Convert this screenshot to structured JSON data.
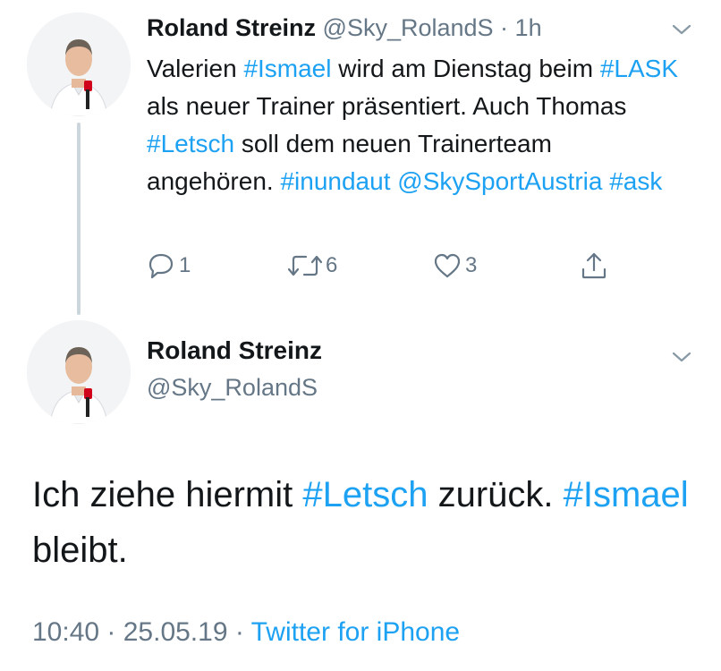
{
  "tweet1": {
    "author_name": "Roland Streinz",
    "author_handle": "@Sky_RolandS",
    "separator": " · ",
    "time": "1h",
    "body": [
      {
        "text": "Valerien ",
        "link": false
      },
      {
        "text": "#Ismael",
        "link": true
      },
      {
        "text": " wird am Dienstag beim ",
        "link": false
      },
      {
        "text": "#LASK",
        "link": true
      },
      {
        "text": " als neuer Trainer präsentiert. Auch Thomas ",
        "link": false
      },
      {
        "text": "#Letsch",
        "link": true
      },
      {
        "text": " soll dem neuen Trainerteam angehören. ",
        "link": false
      },
      {
        "text": "#inundaut",
        "link": true
      },
      {
        "text": " ",
        "link": false
      },
      {
        "text": "@SkySportAustria",
        "link": true
      },
      {
        "text": " ",
        "link": false
      },
      {
        "text": "#ask",
        "link": true
      }
    ],
    "replies": "1",
    "retweets": "6",
    "likes": "3"
  },
  "tweet2": {
    "author_name": "Roland Streinz",
    "author_handle": "@Sky_RolandS",
    "body": [
      {
        "text": "Ich ziehe hiermit ",
        "link": false
      },
      {
        "text": "#Letsch",
        "link": true
      },
      {
        "text": " zurück. ",
        "link": false
      },
      {
        "text": "#Ismael",
        "link": true
      },
      {
        "text": " bleibt.",
        "link": false
      }
    ],
    "footer_time": "10:40 · 25.05.19 · ",
    "footer_source": "Twitter for iPhone"
  },
  "colors": {
    "link": "#1da1f2",
    "secondary_text": "#657786",
    "primary_text": "#14171a",
    "thread_line": "#ccd6dd"
  },
  "icons": [
    "reply-icon",
    "retweet-icon",
    "like-icon",
    "share-icon",
    "chevron-down-icon"
  ]
}
